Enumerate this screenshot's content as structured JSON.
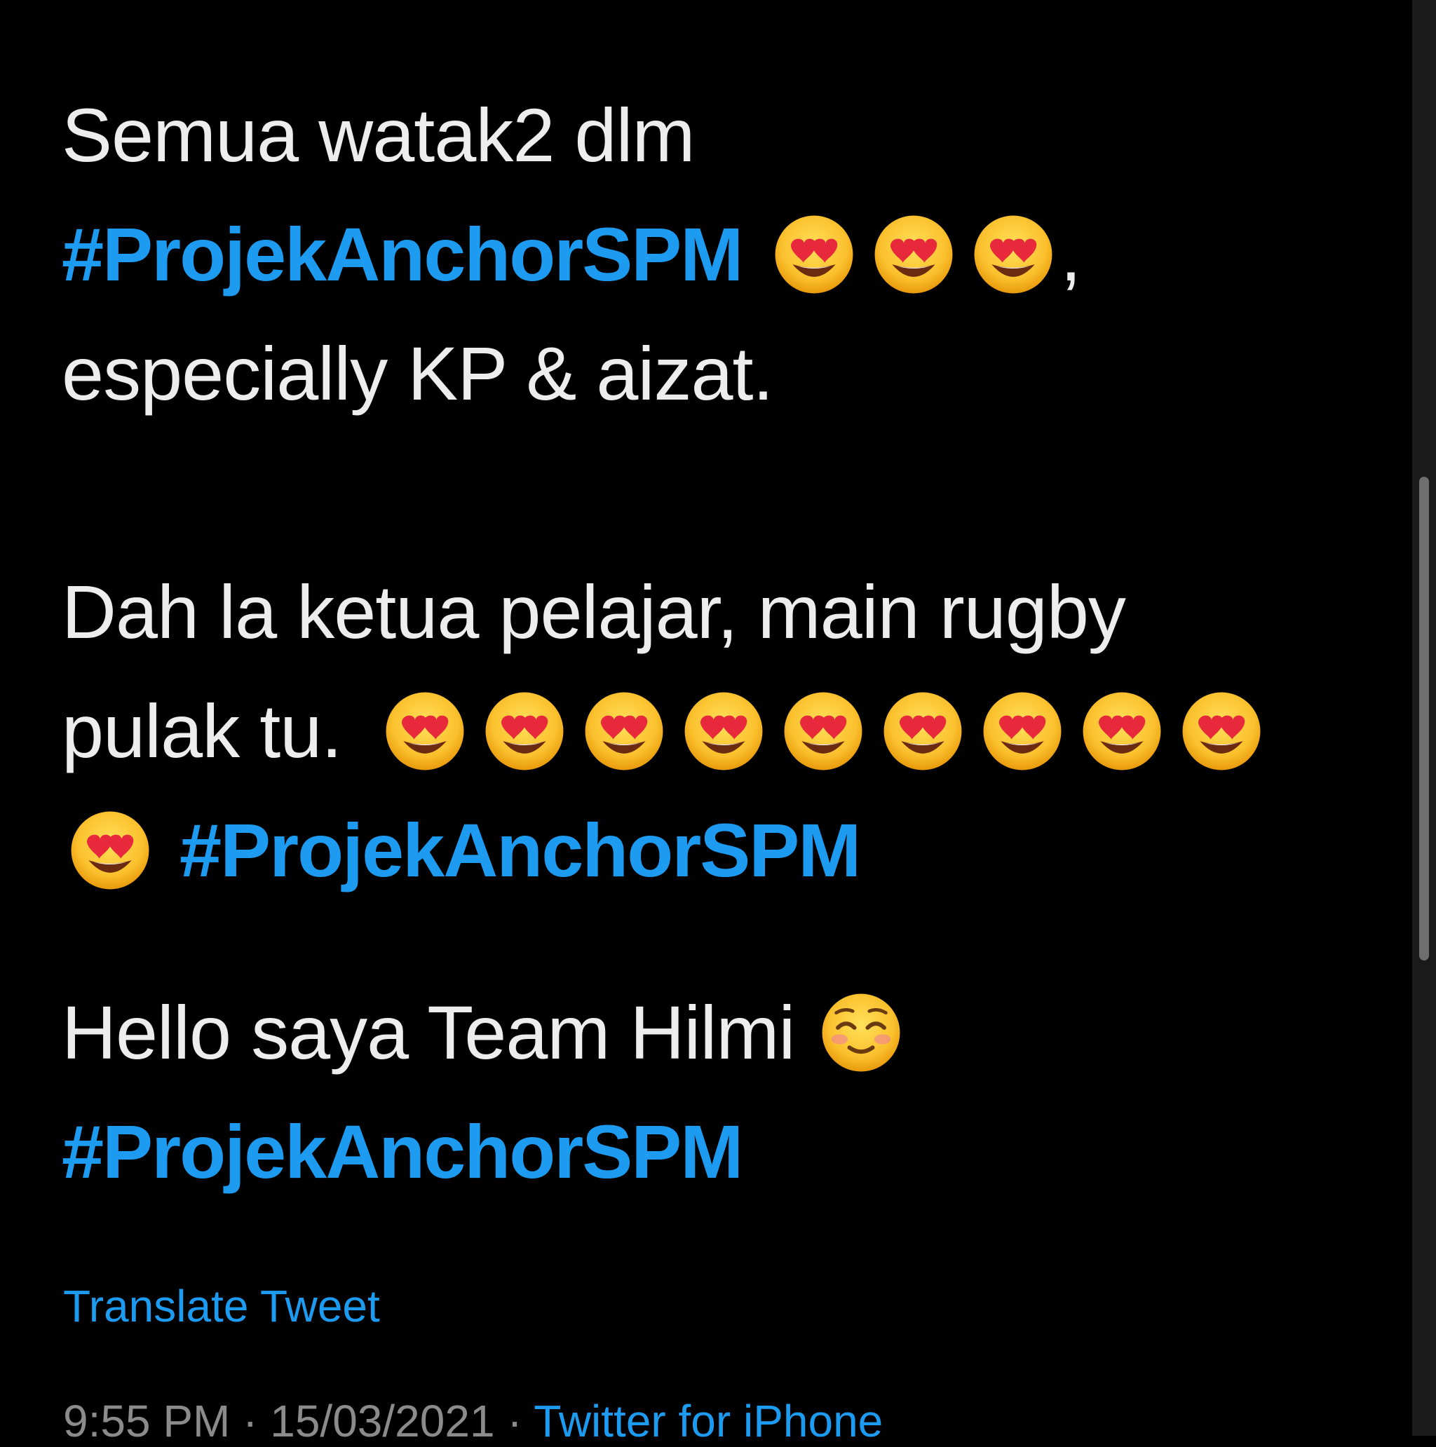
{
  "tweet": {
    "line1": "Semua watak2 dlm",
    "hashtag": "#ProjekAnchorSPM",
    "comma": ",",
    "line3": "especially KP & aizat.",
    "line4": "Dah la ketua pelajar,  main rugby",
    "line5": "pulak tu.",
    "line7": "Hello saya Team Hilmi",
    "emoji_heart_eyes": "heart-eyes-emoji",
    "emoji_smiling": "smiling-face-emoji"
  },
  "actions": {
    "translate_label": "Translate Tweet"
  },
  "meta": {
    "time": "9:55 PM",
    "separator": " · ",
    "date": "15/03/2021",
    "source": "Twitter for iPhone"
  },
  "colors": {
    "background": "#000000",
    "text": "#ededed",
    "link": "#1d9bf0",
    "meta": "#8b8b8b"
  }
}
